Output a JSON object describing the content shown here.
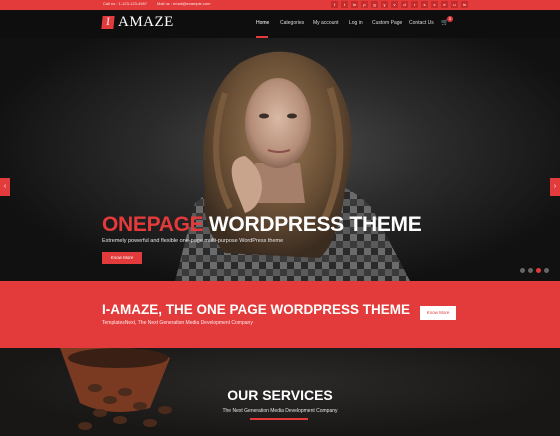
{
  "topbar": {
    "phone": "Call us : 1-123-123-4567",
    "email": "Mail us : email@example.com",
    "social": [
      "f",
      "t",
      "in",
      "p",
      "g",
      "y",
      "v",
      "d",
      "r",
      "s",
      "x",
      "e",
      "u",
      "in"
    ]
  },
  "header": {
    "logo_mark": "I",
    "logo_text": "AMAZE",
    "nav": [
      "Home",
      "Categories",
      "My account",
      "Log in",
      "Custom Page",
      "Contact Us"
    ],
    "cart_count": "0"
  },
  "hero": {
    "title_accent": "ONEPAGE",
    "title_rest": " WORDPRESS THEME",
    "subtitle": "Extremely powerful and flexible one-page multi-purpose WordPress theme",
    "button": "Know More",
    "prev_arrow": "‹",
    "next_arrow": "›"
  },
  "band": {
    "title": "I-AMAZE, THE ONE PAGE WORDPRESS THEME",
    "subtitle": "TemplatesNext, The Next Generation Media Development Company",
    "button": "Know More"
  },
  "services": {
    "title": "OUR SERVICES",
    "subtitle": "The Next Generation Media Development Company"
  },
  "colors": {
    "accent": "#e33b3b",
    "dark": "#0e0e0e"
  }
}
